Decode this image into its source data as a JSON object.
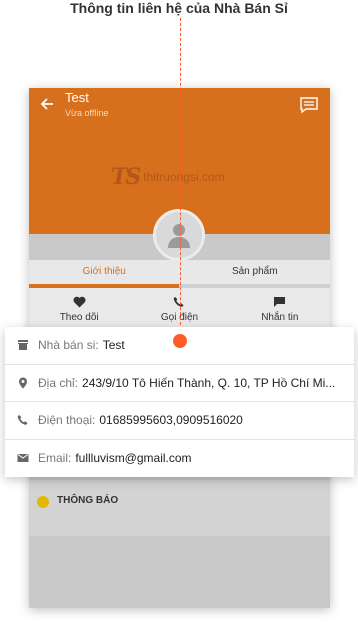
{
  "caption": "Thông tin liên hệ của Nhà Bán Sỉ",
  "header": {
    "title": "Test",
    "status": "Vừa offline"
  },
  "watermark": {
    "logo": "TS",
    "text": "thitruongsi.com"
  },
  "tabs": [
    {
      "label": "Giới thiệu",
      "active": true
    },
    {
      "label": "Sản phẩm",
      "active": false
    }
  ],
  "actions": [
    {
      "label": "Theo dõi",
      "icon": "heart-icon"
    },
    {
      "label": "Gọi điện",
      "icon": "phone-icon"
    },
    {
      "label": "Nhắn tin",
      "icon": "message-icon"
    }
  ],
  "contact": {
    "seller": {
      "label": "Nhà bán si:",
      "value": "Test",
      "icon": "store-icon"
    },
    "address": {
      "label": "Địa chỉ:",
      "value": "243/9/10 Tô Hiến Thành, Q. 10, TP Hồ Chí Mi...",
      "icon": "location-icon"
    },
    "phone": {
      "label": "Điện thoại:",
      "value": "01685995603,0909516020",
      "icon": "phone-icon"
    },
    "email": {
      "label": "Email:",
      "value": "fullluvism@gmail.com",
      "icon": "email-icon"
    }
  },
  "notice": {
    "label": "THÔNG BÁO"
  },
  "colors": {
    "accent": "#d6701c",
    "callout": "#ff5a2a",
    "notice": "#e2b900"
  }
}
